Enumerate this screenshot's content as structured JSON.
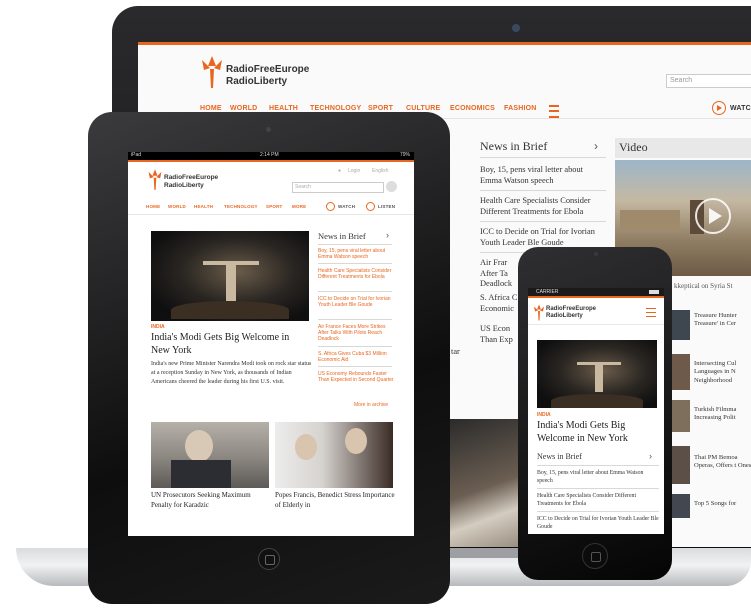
{
  "brand": {
    "line1": "RadioFreeEurope",
    "line2": "RadioLiberty",
    "color": "#e8661f"
  },
  "laptop": {
    "search_placeholder": "Search",
    "nav": [
      "HOME",
      "WORLD",
      "HEALTH",
      "TECHNOLOGY",
      "SPORT",
      "CULTURE",
      "ECONOMICS",
      "FASHION"
    ],
    "watch_label": "WATC",
    "news_in_brief": {
      "title": "News in Brief",
      "items": [
        "Boy, 15, pens viral letter about Emma Watson speech",
        "Health Care Specialists Consider Different Treatments for Ebola",
        "ICC to Decide on Trial for Ivorian Youth Leader Ble Goude",
        "Air Frar After Ta Deadlock",
        "S. Africa C Economic",
        "US Econ Than Exp"
      ]
    },
    "video_title": "Video",
    "video_caption": "kkeptical on Syria St",
    "side_items": [
      "Treasure Hunter Treasure' in Cer",
      "Intersecting Cul Languages in N Neighborhood",
      "Turkish Filmma Increasing Polit",
      "Thai PM Bemoa Operas, Offers t Ones",
      "Top 5 Songs for"
    ],
    "partial_caption": "tar"
  },
  "tablet": {
    "status": {
      "left": "iPad",
      "time": "2:14 PM",
      "right": "79%"
    },
    "top_links": [
      "Login",
      "English"
    ],
    "search_placeholder": "Search",
    "nav": [
      "HOME",
      "WORLD",
      "HEALTH",
      "TECHNOLOGY",
      "SPORT",
      "MORE"
    ],
    "watch_label": "WATCH",
    "listen_label": "LISTEN",
    "category": "INDIA",
    "headline": "India's Modi Gets Big Welcome in New York",
    "summary": "India's new Prime Minister Narendra Modi took on rock star status at a reception Sunday in New York, as thousands of Indian Americans cheered the leader during his first U.S. visit.",
    "news_in_brief": {
      "title": "News in Brief",
      "items": [
        "Boy, 15, pens viral letter about Emma Watson speech",
        "Health Care Specialists Consider Different Treatments for Ebola",
        "ICC to Decide on Trial for Ivorian Youth Leader Ble Goude",
        "Air France Faces More Strikes After Talks With Pilots Reach Deadlock",
        "S. Africa Gives Cuba $3 Million Economic Aid",
        "US Economy Rebounds Faster Than Expected in Second Quarter"
      ],
      "more_link": "More in archive"
    },
    "story2": "UN Prosecutors Seeking Maximum Penalty for Karadzic",
    "story3": "Popes Francis, Benedict Stress Importance of Elderly in"
  },
  "phone": {
    "carrier": "CARRIER",
    "category": "INDIA",
    "headline": "India's Modi Gets Big Welcome in New York",
    "news_in_brief": {
      "title": "News in Brief",
      "items": [
        "Boy, 15, pens viral letter about Emma Watson speech",
        "Health Care Specialists Consider Different Treatments for Ebola",
        "ICC to Decide on Trial for Ivorian Youth Leader Ble Goude"
      ]
    }
  }
}
